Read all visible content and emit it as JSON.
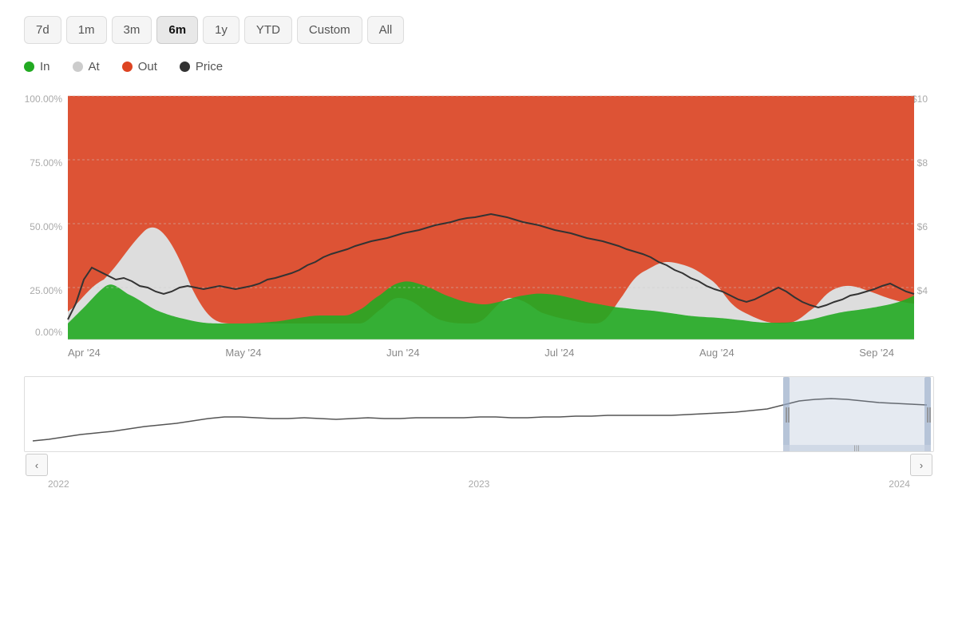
{
  "timeButtons": [
    {
      "label": "7d",
      "id": "7d",
      "active": false
    },
    {
      "label": "1m",
      "id": "1m",
      "active": false
    },
    {
      "label": "3m",
      "id": "3m",
      "active": false
    },
    {
      "label": "6m",
      "id": "6m",
      "active": true
    },
    {
      "label": "1y",
      "id": "1y",
      "active": false
    },
    {
      "label": "YTD",
      "id": "ytd",
      "active": false
    },
    {
      "label": "Custom",
      "id": "custom",
      "active": false
    },
    {
      "label": "All",
      "id": "all",
      "active": false
    }
  ],
  "legend": [
    {
      "label": "In",
      "color": "#22aa22",
      "id": "in"
    },
    {
      "label": "At",
      "color": "#cccccc",
      "id": "at"
    },
    {
      "label": "Out",
      "color": "#dd4422",
      "id": "out"
    },
    {
      "label": "Price",
      "color": "#333333",
      "id": "price"
    }
  ],
  "yAxisLabels": [
    "100.00%",
    "75.00%",
    "50.00%",
    "25.00%",
    "0.00%"
  ],
  "yAxisPrices": [
    "$10",
    "$8",
    "$6",
    "$4"
  ],
  "xAxisLabels": [
    "Apr '24",
    "May '24",
    "Jun '24",
    "Jul '24",
    "Aug '24",
    "Sep '24"
  ],
  "miniLabels": [
    "2022",
    "2023",
    "2024"
  ],
  "navButtons": {
    "prev": "‹",
    "next": "›",
    "handle": "|||"
  }
}
